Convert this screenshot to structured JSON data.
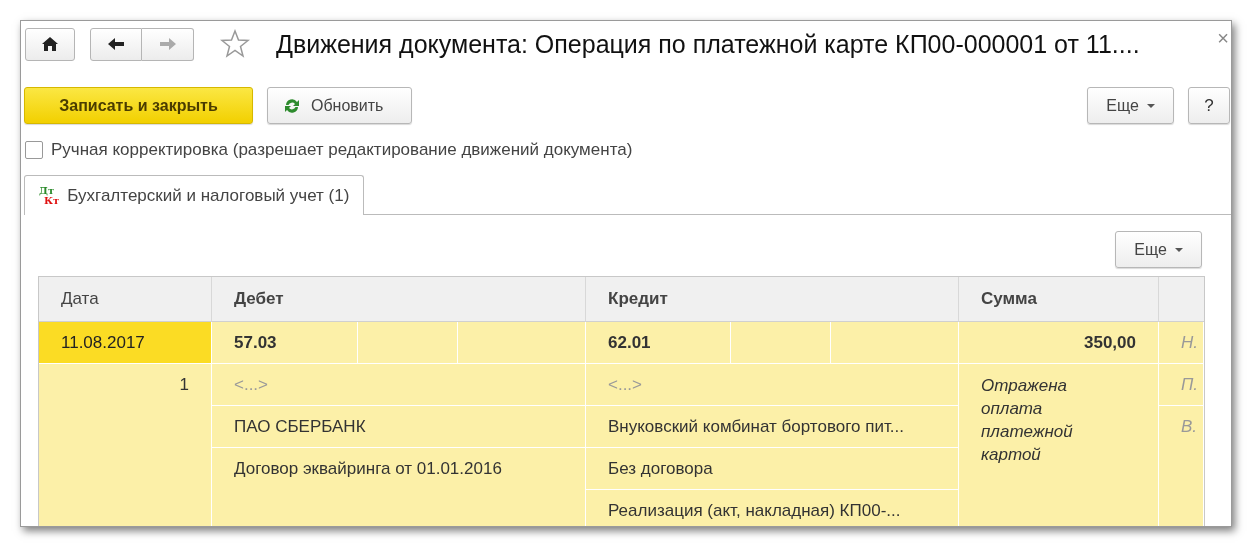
{
  "window": {
    "title": "Движения документа: Операция по платежной карте КП00-000001 от 11....",
    "close": "×"
  },
  "nav": {
    "back": {
      "disabled": false
    },
    "forward": {
      "disabled": true
    }
  },
  "toolbar": {
    "primary": "Записать и закрыть",
    "refresh": "Обновить",
    "more": "Еще",
    "help": "?"
  },
  "manual_correction": {
    "label": "Ручная корректировка (разрешает редактирование движений документа)",
    "checked": false
  },
  "tabs": [
    {
      "label": "Бухгалтерский и налоговый учет (1)",
      "icon_text": [
        "Дт",
        "Кт"
      ],
      "selected": true
    }
  ],
  "table_toolbar": {
    "more": "Еще"
  },
  "table": {
    "columns": [
      "Дата",
      "Дебет",
      "Кредит",
      "Сумма"
    ],
    "rows": [
      {
        "date": "11.08.2017",
        "number": "1",
        "selected": true,
        "debit": {
          "account": "57.03",
          "subconto": [
            "<...>",
            "ПАО СБЕРБАНК",
            "Договор эквайринга от 01.01.2016"
          ]
        },
        "credit": {
          "account": "62.01",
          "subconto": [
            "<...>",
            "Внуковский комбинат бортового пит...",
            "Без договора",
            "Реализация (акт, накладная) КП00-..."
          ]
        },
        "amount": "350,00",
        "content": "Отражена оплата платежной картой",
        "column_5": [
          "Н.",
          "П.",
          "В."
        ]
      }
    ]
  }
}
